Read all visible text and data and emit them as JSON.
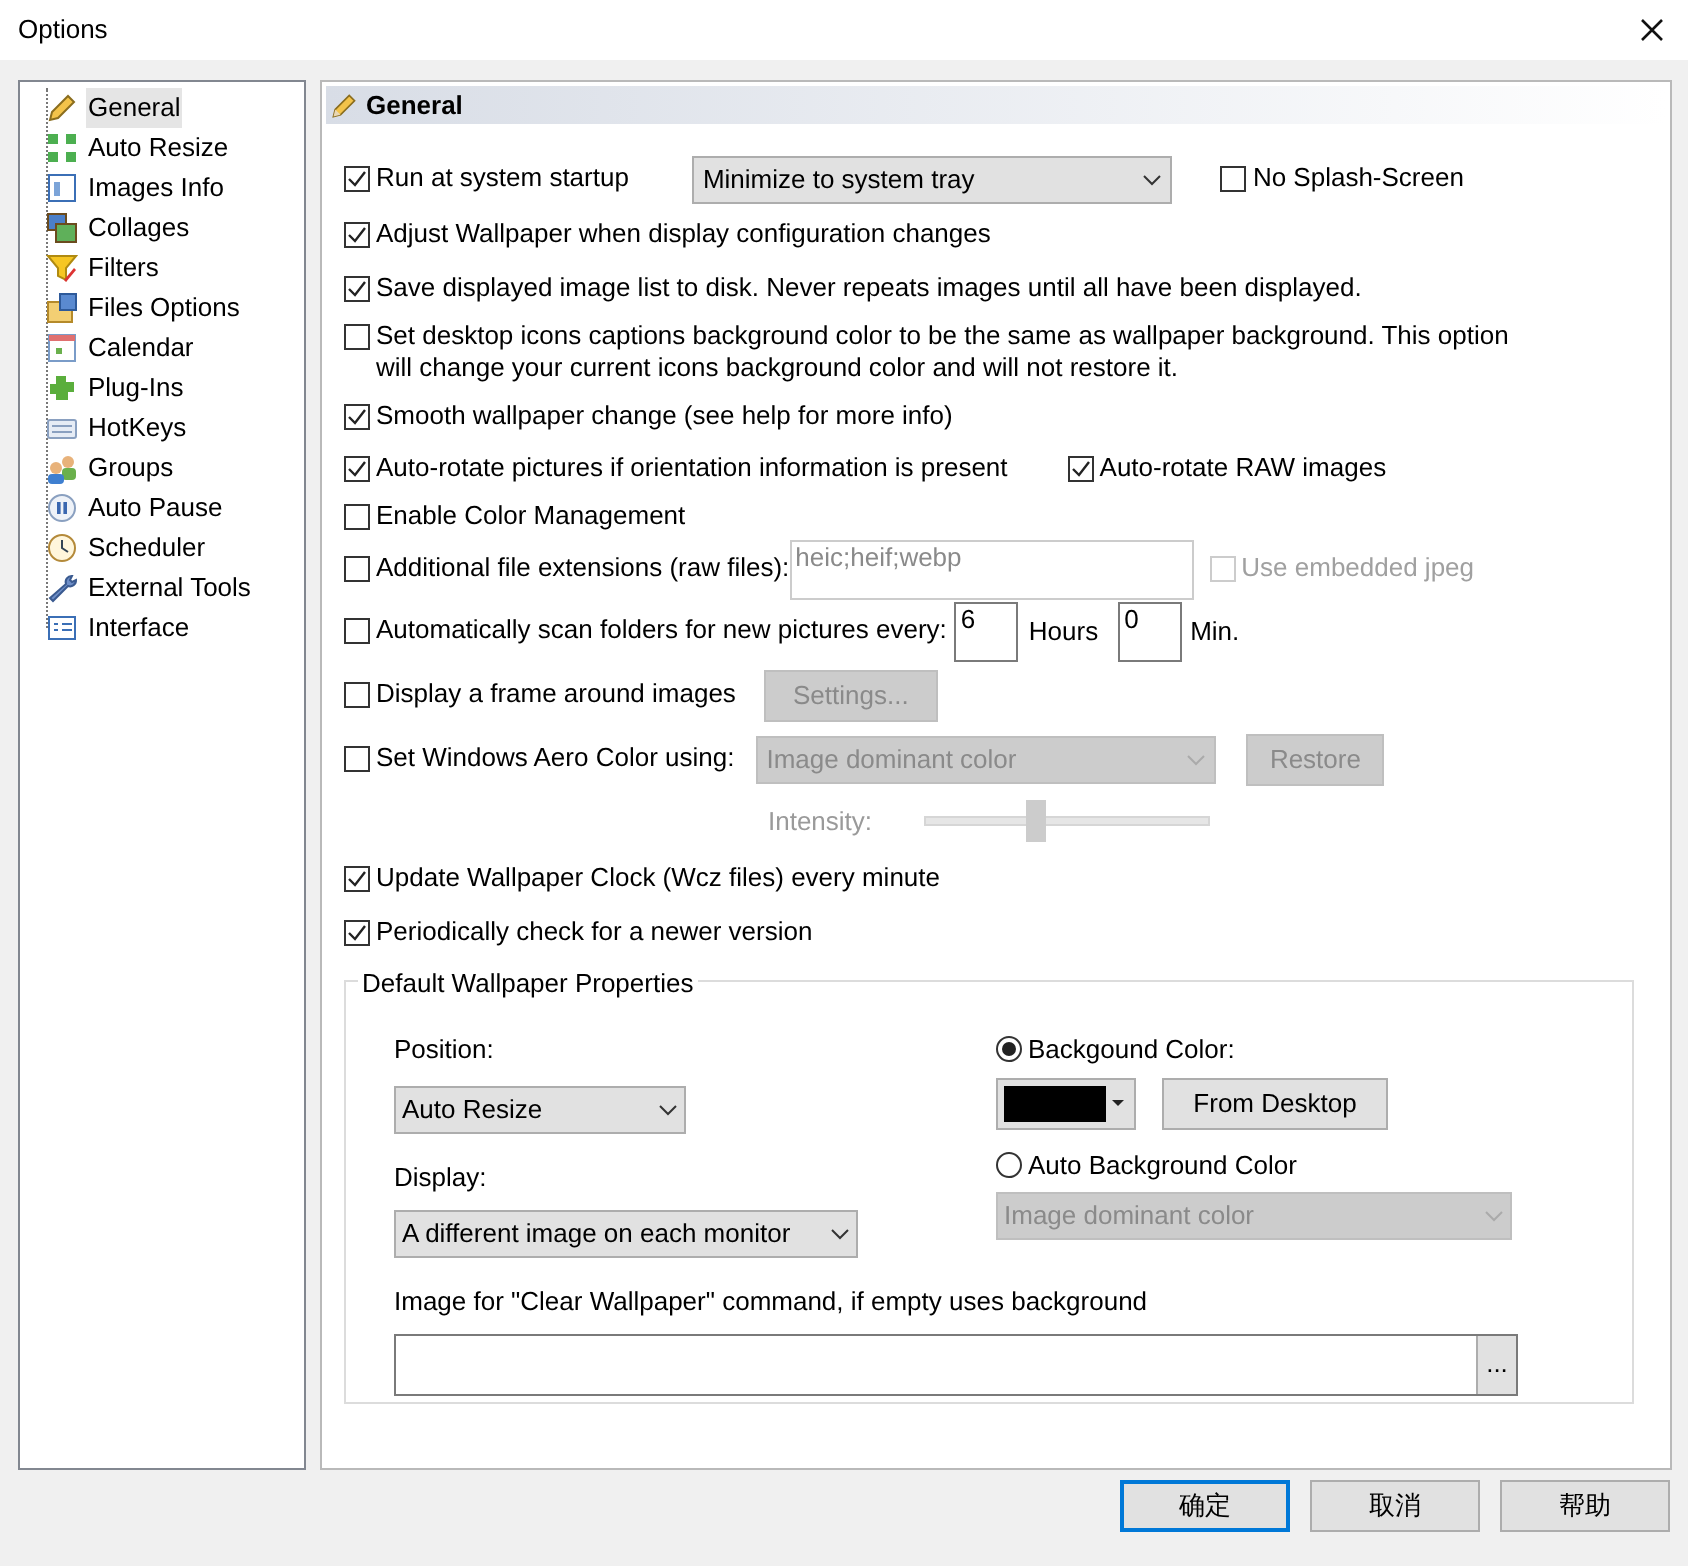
{
  "window": {
    "title": "Options"
  },
  "sidebar": {
    "items": [
      {
        "label": "General",
        "selected": true
      },
      {
        "label": "Auto Resize",
        "selected": false
      },
      {
        "label": "Images Info",
        "selected": false
      },
      {
        "label": "Collages",
        "selected": false
      },
      {
        "label": "Filters",
        "selected": false
      },
      {
        "label": "Files Options",
        "selected": false
      },
      {
        "label": "Calendar",
        "selected": false
      },
      {
        "label": "Plug-Ins",
        "selected": false
      },
      {
        "label": "HotKeys",
        "selected": false
      },
      {
        "label": "Groups",
        "selected": false
      },
      {
        "label": "Auto Pause",
        "selected": false
      },
      {
        "label": "Scheduler",
        "selected": false
      },
      {
        "label": "External Tools",
        "selected": false
      },
      {
        "label": "Interface",
        "selected": false
      }
    ]
  },
  "panel": {
    "title": "General",
    "options": [
      {
        "controls": [
          {
            "kind": "checkbox",
            "label": "Run at system startup",
            "checked": true
          },
          {
            "kind": "dropdown",
            "value": "Minimize to system tray",
            "disabled": false
          },
          {
            "kind": "checkbox",
            "label": "No Splash-Screen",
            "checked": false
          }
        ]
      },
      {
        "controls": [
          {
            "kind": "checkbox",
            "label": "Adjust Wallpaper when display configuration changes",
            "checked": true
          }
        ]
      },
      {
        "controls": [
          {
            "kind": "checkbox",
            "label": "Save displayed image list to disk. Never repeats images until all have been displayed.",
            "checked": true
          }
        ]
      },
      {
        "controls": [
          {
            "kind": "checkbox",
            "label": "Set desktop icons captions background color to be the same as wallpaper background. This option will change your current icons background color and will not restore it.",
            "checked": false
          }
        ]
      },
      {
        "controls": [
          {
            "kind": "checkbox",
            "label": "Smooth wallpaper change (see help for more info)",
            "checked": true
          }
        ]
      },
      {
        "controls": [
          {
            "kind": "checkbox",
            "label": "Auto-rotate pictures if orientation information is present",
            "checked": true
          },
          {
            "kind": "checkbox",
            "label": "Auto-rotate RAW images",
            "checked": true
          }
        ]
      },
      {
        "controls": [
          {
            "kind": "checkbox",
            "label": "Enable Color Management",
            "checked": false
          }
        ]
      },
      {
        "controls": [
          {
            "kind": "checkbox",
            "label": "Additional file extensions (raw files):",
            "checked": false
          },
          {
            "kind": "field",
            "value": "heic;heif;webp",
            "disabled": true
          },
          {
            "kind": "checkbox",
            "label": "Use embedded jpeg",
            "checked": false,
            "disabled": true
          }
        ]
      },
      {
        "controls": [
          {
            "kind": "checkbox",
            "label": "Automatically scan folders for new pictures every:",
            "checked": false
          },
          {
            "kind": "field",
            "value": "6",
            "disabled": false
          },
          {
            "kind": "label",
            "text": "Hours"
          },
          {
            "kind": "field",
            "value": "0",
            "disabled": false
          },
          {
            "kind": "label",
            "text": "Min."
          }
        ]
      },
      {
        "controls": [
          {
            "kind": "checkbox",
            "label": "Display a frame around images",
            "checked": false
          },
          {
            "kind": "button",
            "label": "Settings...",
            "disabled": true
          }
        ]
      },
      {
        "controls": [
          {
            "kind": "checkbox",
            "label": "Set Windows Aero Color using:",
            "checked": false
          },
          {
            "kind": "dropdown",
            "value": "Image dominant color",
            "disabled": true
          },
          {
            "kind": "button",
            "label": "Restore",
            "disabled": true
          }
        ]
      },
      {
        "controls": [
          {
            "kind": "label",
            "text": "Intensity:",
            "disabled": true
          },
          {
            "kind": "slider",
            "level": 0.39,
            "disabled": true
          }
        ]
      },
      {
        "controls": [
          {
            "kind": "checkbox",
            "label": "Update Wallpaper Clock (Wcz files) every minute",
            "checked": true
          }
        ]
      },
      {
        "controls": [
          {
            "kind": "checkbox",
            "label": "Periodically check for a newer version",
            "checked": true
          }
        ]
      }
    ]
  },
  "wallpaper_properties": {
    "title": "Default Wallpaper Properties",
    "position": {
      "label": "Position:",
      "value": "Auto Resize"
    },
    "display": {
      "label": "Display:",
      "value": "A different image on each monitor"
    },
    "background_color": {
      "label": "Backgound Color:",
      "selected": true,
      "color": "#000000",
      "button": "From Desktop"
    },
    "auto_background": {
      "label": "Auto Background Color",
      "selected": false,
      "value": "Image dominant color",
      "disabled": true
    },
    "clear_image": {
      "label": "Image for \"Clear Wallpaper\" command, if empty uses background",
      "browse": "..."
    }
  },
  "buttons": [
    {
      "label": "确定",
      "default": true
    },
    {
      "label": "取消",
      "default": false
    },
    {
      "label": "帮助",
      "default": false
    }
  ]
}
